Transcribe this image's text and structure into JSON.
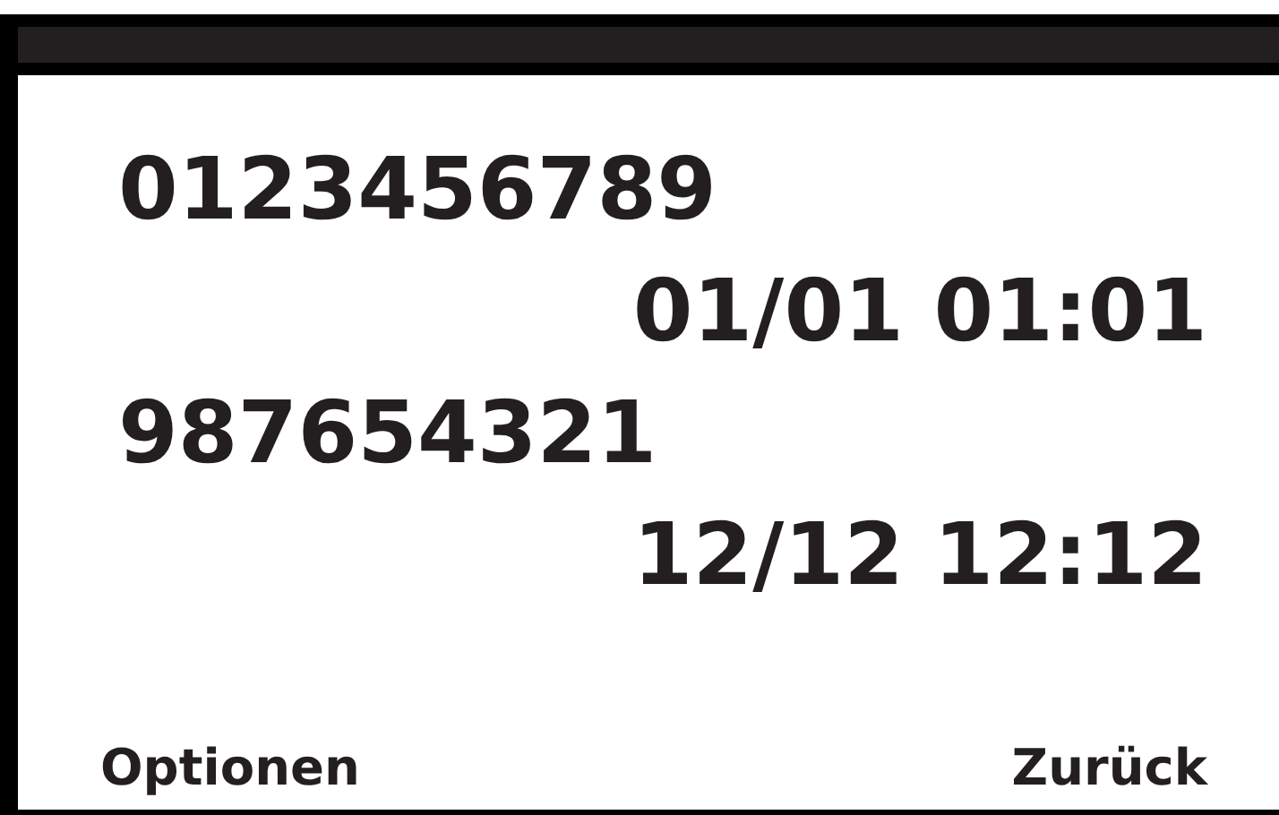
{
  "entries": [
    {
      "number": "0123456789",
      "datetime": "01/01 01:01"
    },
    {
      "number": "987654321",
      "datetime": "12/12 12:12"
    }
  ],
  "softkeys": {
    "left": "Optionen",
    "right": "Zurück"
  }
}
